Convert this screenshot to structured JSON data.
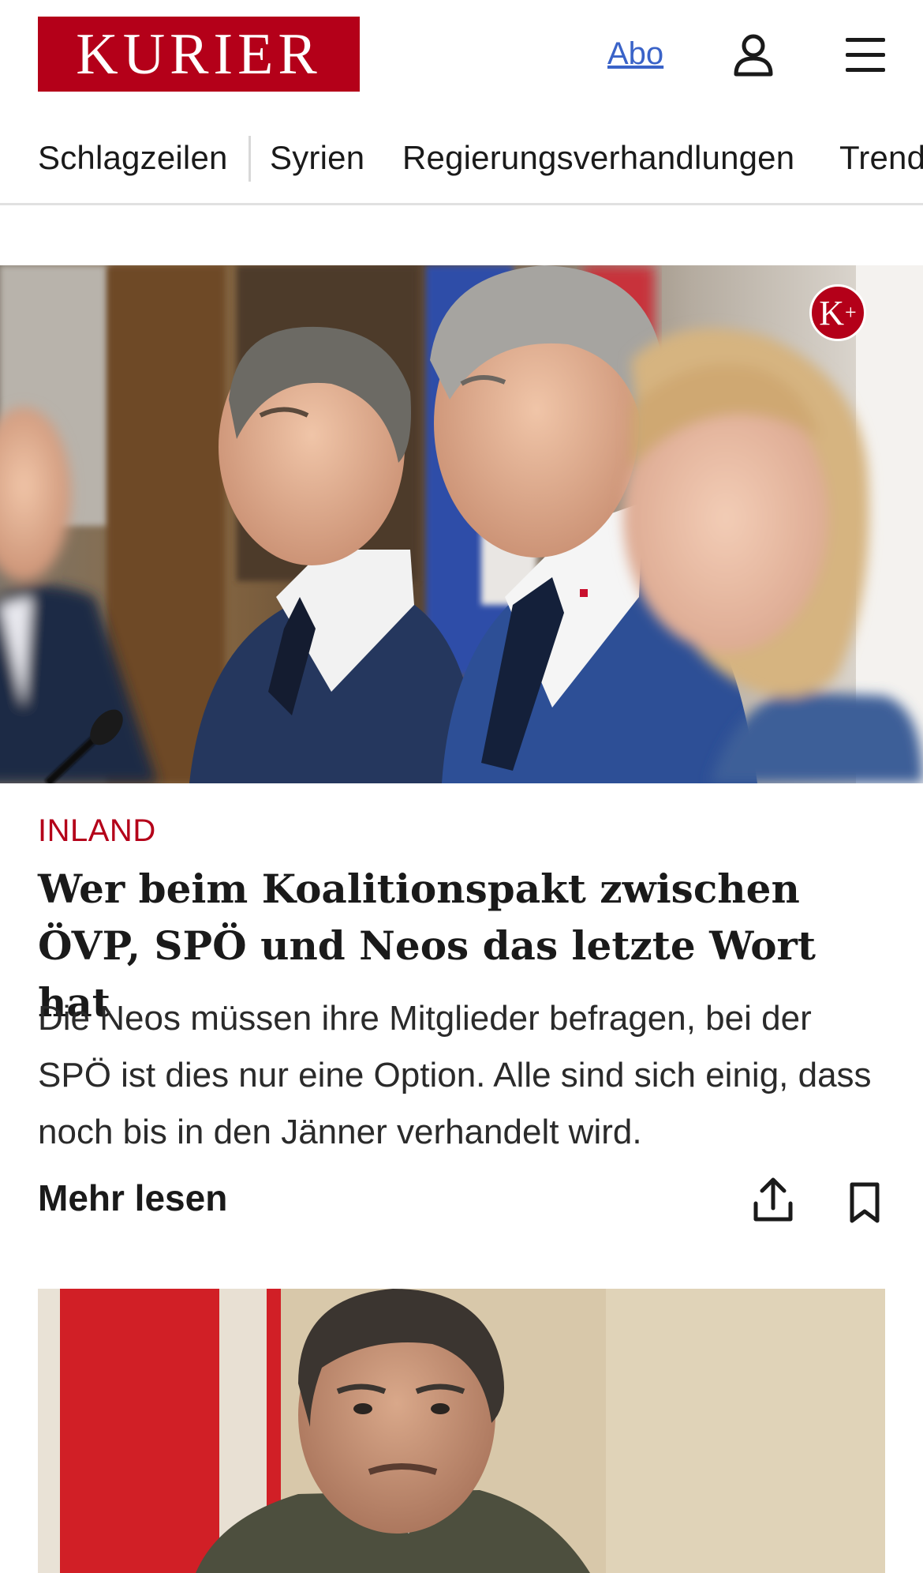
{
  "header": {
    "logo_text": "KURIER",
    "abo_label": "Abo",
    "user_icon": "user-icon",
    "menu_icon": "hamburger-menu-icon"
  },
  "nav": {
    "items": [
      {
        "label": "Schlagzeilen"
      },
      {
        "label": "Syrien"
      },
      {
        "label": "Regierungsverhandlungen"
      },
      {
        "label": "Trend"
      }
    ]
  },
  "article": {
    "premium_badge": "K",
    "premium_badge_plus": "+",
    "category": "INLAND",
    "headline": "Wer beim Koalitionspakt zwischen ÖVP, SPÖ und Neos das letzte Wort hat",
    "teaser": "Die Neos müssen ihre Mitglieder befragen, bei der SPÖ ist dies nur eine Option. Alle sind sich einig, dass noch bis in den Jänner verhandelt wird.",
    "more_label": "Mehr lesen",
    "share_icon": "share-icon",
    "bookmark_icon": "bookmark-icon"
  },
  "colors": {
    "brand": "#b40019",
    "link": "#3a63c8"
  }
}
